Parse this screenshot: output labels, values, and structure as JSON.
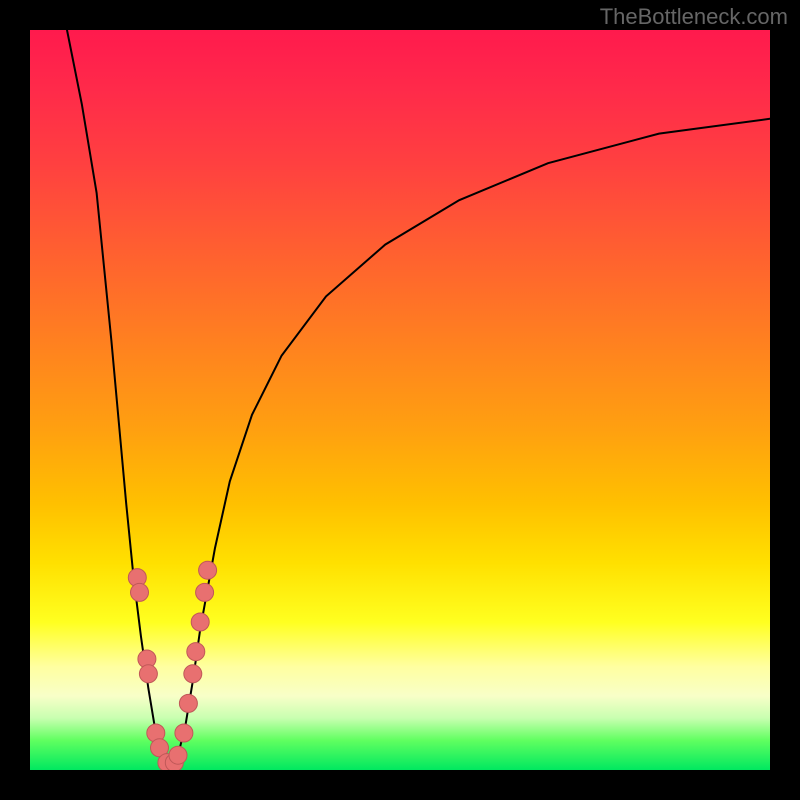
{
  "watermark": "TheBottleneck.com",
  "colors": {
    "frame": "#000000",
    "gradient_top": "#ff1a4d",
    "gradient_mid": "#ffd000",
    "gradient_bottom": "#00e860",
    "curve": "#000000",
    "marker_fill": "#e87070",
    "marker_stroke": "#c05858"
  },
  "chart_data": {
    "type": "line",
    "title": "",
    "xlabel": "",
    "ylabel": "",
    "xlim": [
      0,
      100
    ],
    "ylim": [
      0,
      100
    ],
    "curve_left": {
      "comment": "Steep descending branch entering from top, reaching minimum near x≈18",
      "points": [
        [
          5,
          100
        ],
        [
          7,
          90
        ],
        [
          9,
          78
        ],
        [
          10,
          68
        ],
        [
          11,
          58
        ],
        [
          12,
          47
        ],
        [
          13,
          36
        ],
        [
          14,
          26
        ],
        [
          15,
          18
        ],
        [
          16,
          11
        ],
        [
          17,
          5
        ],
        [
          18,
          1
        ],
        [
          19,
          0
        ]
      ]
    },
    "curve_right": {
      "comment": "Rising branch from the same minimum, curving up and right toward ~y≈88 at x=100",
      "points": [
        [
          19,
          0
        ],
        [
          20,
          2
        ],
        [
          21,
          6
        ],
        [
          22,
          12
        ],
        [
          23,
          19
        ],
        [
          25,
          30
        ],
        [
          27,
          39
        ],
        [
          30,
          48
        ],
        [
          34,
          56
        ],
        [
          40,
          64
        ],
        [
          48,
          71
        ],
        [
          58,
          77
        ],
        [
          70,
          82
        ],
        [
          85,
          86
        ],
        [
          100,
          88
        ]
      ]
    },
    "markers": {
      "comment": "Pink circular markers clustered around the V near the bottom",
      "points": [
        [
          14.5,
          26
        ],
        [
          14.8,
          24
        ],
        [
          15.8,
          15
        ],
        [
          16.0,
          13
        ],
        [
          17.0,
          5
        ],
        [
          17.5,
          3
        ],
        [
          18.5,
          1
        ],
        [
          19.5,
          1
        ],
        [
          20.0,
          2
        ],
        [
          20.8,
          5
        ],
        [
          21.4,
          9
        ],
        [
          22.0,
          13
        ],
        [
          22.4,
          16
        ],
        [
          23.0,
          20
        ],
        [
          23.6,
          24
        ],
        [
          24.0,
          27
        ]
      ]
    }
  }
}
